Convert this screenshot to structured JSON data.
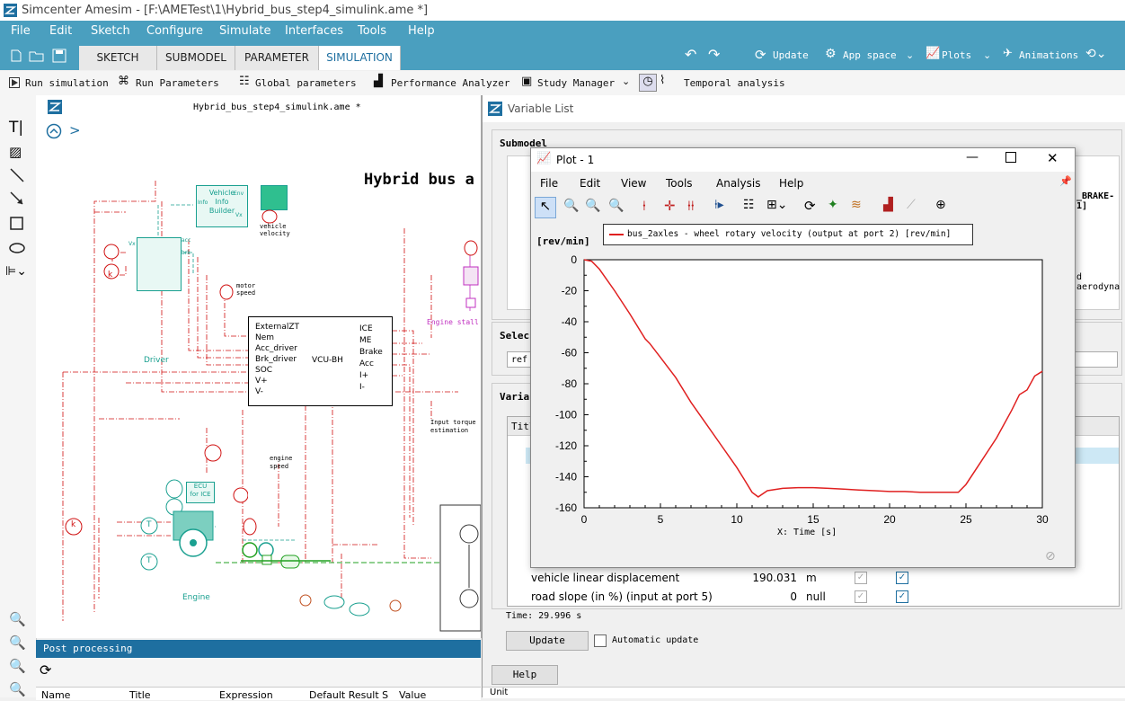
{
  "app": {
    "title": "Simcenter Amesim - [F:\\AMETest\\1\\Hybrid_bus_step4_simulink.ame *]"
  },
  "menu": [
    "File",
    "Edit",
    "Sketch",
    "Configure",
    "Simulate",
    "Interfaces",
    "Tools",
    "Help"
  ],
  "tabs": [
    "SKETCH",
    "SUBMODEL",
    "PARAMETER",
    "SIMULATION"
  ],
  "ribbon_right": {
    "update": "Update",
    "app_space": "App space",
    "plots": "Plots",
    "animations": "Animations"
  },
  "toolbar": {
    "run": "Run simulation",
    "run_params": "Run Parameters",
    "global": "Global parameters",
    "perf": "Performance Analyzer",
    "study": "Study Manager",
    "temporal": "Temporal analysis"
  },
  "sketch": {
    "file_label": "Hybrid_bus_step4_simulink.ame *",
    "heading": "Hybrid bus a",
    "vib": [
      "Vehicle",
      "Info",
      "Builder"
    ],
    "vib_ports": [
      "Info",
      "Env",
      "Vx"
    ],
    "vehicle_velocity": [
      "vehicle",
      "velocity"
    ],
    "motor_speed": [
      "motor",
      "speed"
    ],
    "driver": "Driver",
    "driver_ports": [
      "Vx",
      "acc",
      "brk"
    ],
    "k": "k",
    "vcu_inputs": [
      "ExternalZT",
      "Nem",
      "Acc_driver",
      "Brk_driver",
      "SOC",
      "V+",
      "V-"
    ],
    "vcu_name": "VCU-BH",
    "vcu_outputs": [
      "ICE",
      "ME",
      "Brake",
      "Acc",
      "I+",
      "I-"
    ],
    "engine_stall": "Engine stall",
    "input_torque": [
      "Input torque",
      "estimation"
    ],
    "engine_speed": [
      "engine",
      "speed"
    ],
    "ecu": [
      "ECU",
      "for ICE"
    ],
    "engine": "Engine",
    "T": "T"
  },
  "post": {
    "title": "Post processing",
    "columns": [
      "Name",
      "Title",
      "Expression",
      "Default Result S",
      "Value"
    ]
  },
  "varlist": {
    "title": "Variable List",
    "submodel_label": "Submodel",
    "submodel_value": "_BRAKE-1]",
    "aero_text": "d aerodyna",
    "select_label": "Selec",
    "select_value": "ref",
    "variables_label": "Varia",
    "col_title": "Titl",
    "rows": [
      {
        "name": "vehicle linear displacement",
        "value": "190.031",
        "unit": "m"
      },
      {
        "name": "road slope (in %) (input at port 5)",
        "value": "0",
        "unit": "null"
      }
    ],
    "time": "Time: 29.996 s",
    "update_btn": "Update",
    "auto_update": "Automatic update",
    "help_btn": "Help",
    "unit_label": "Unit"
  },
  "plot": {
    "title": "Plot - 1",
    "menu": [
      "File",
      "Edit",
      "View",
      "Tools",
      "Analysis",
      "Help"
    ],
    "unit_label": "[rev/min]",
    "legend": "bus_2axles - wheel rotary velocity (output at port 2) [rev/min]",
    "x_axis_label": "X: Time [s]"
  },
  "chart_data": {
    "type": "line",
    "xlabel": "X: Time [s]",
    "ylabel": "[rev/min]",
    "xlim": [
      0,
      30
    ],
    "ylim": [
      -160,
      0
    ],
    "xticks": [
      "0",
      "5",
      "10",
      "15",
      "20",
      "25",
      "30"
    ],
    "yticks": [
      "0",
      "-20",
      "-40",
      "-60",
      "-80",
      "-100",
      "-120",
      "-140",
      "-160"
    ],
    "series": [
      {
        "name": "bus_2axles - wheel rotary velocity (output at port 2) [rev/min]",
        "color": "#e02020",
        "x": [
          0,
          0.5,
          1,
          2,
          3,
          4,
          4.3,
          5,
          6,
          7,
          8,
          9,
          10,
          10.5,
          11,
          11.4,
          12,
          13,
          14,
          15,
          16,
          17,
          18,
          19,
          20,
          21,
          22,
          23,
          24,
          24.5,
          25,
          26,
          27,
          28,
          28.5,
          29,
          29.5,
          30
        ],
        "y": [
          0,
          -1,
          -6,
          -20,
          -35,
          -51,
          -54,
          -63,
          -76,
          -92,
          -106,
          -120,
          -134,
          -142,
          -150,
          -153,
          -149,
          -147.5,
          -147,
          -147,
          -147.5,
          -148,
          -148.5,
          -149,
          -149.5,
          -149.5,
          -150,
          -150,
          -150,
          -150,
          -145,
          -130,
          -115,
          -97,
          -87,
          -84,
          -75,
          -72
        ]
      }
    ]
  }
}
